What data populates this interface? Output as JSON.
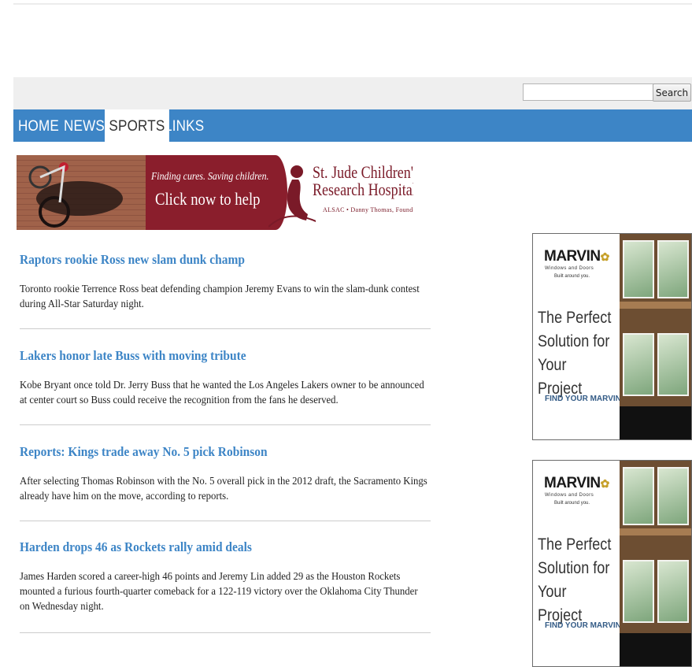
{
  "search": {
    "placeholder": "",
    "value": "",
    "button_label": "Search"
  },
  "nav": {
    "items": [
      {
        "label": "HOME"
      },
      {
        "label": "NEWS"
      },
      {
        "label": "SPORTS",
        "active": true
      },
      {
        "label": "LINKS"
      }
    ]
  },
  "banner": {
    "tagline": "Finding cures. Saving children.",
    "cta": "Click now to help",
    "org_line1": "St. Jude Children's",
    "org_line2": "Research Hospital",
    "org_sub": "ALSAC • Danny Thomas, Founder"
  },
  "articles": [
    {
      "title": "Raptors rookie Ross new slam dunk champ",
      "summary": "Toronto rookie Terrence Ross beat defending champion Jeremy Evans to win the slam-dunk contest during All-Star Saturday night."
    },
    {
      "title": "Lakers honor late Buss with moving tribute",
      "summary": "Kobe Bryant once told Dr. Jerry Buss that he wanted the Los Angeles Lakers owner to be announced at center court so Buss could receive the recognition from the fans he deserved."
    },
    {
      "title": "Reports: Kings trade away No. 5 pick Robinson",
      "summary": "After selecting Thomas Robinson with the No. 5 overall pick in the 2012 draft, the Sacramento Kings already have him on the move, according to reports."
    },
    {
      "title": "Harden drops 46 as Rockets rally amid deals",
      "summary": "James Harden scored a career-high 46 points and Jeremy Lin added 29 as the Houston Rockets mounted a furious fourth-quarter comeback for a 122-119 victory over the Oklahoma City Thunder on Wednesday night."
    }
  ],
  "ads": [
    {
      "brand": "MARVIN",
      "brand_sub": "Windows and Doors",
      "tagline": "Built around you.",
      "headline": "The Perfect Solution for Your Project",
      "cta": "FIND YOUR MARVIN ▸"
    },
    {
      "brand": "MARVIN",
      "brand_sub": "Windows and Doors",
      "tagline": "Built around you.",
      "headline": "The Perfect Solution for Your Project",
      "cta": "FIND YOUR MARVIN ▸"
    }
  ],
  "colors": {
    "nav_bg": "#3d85c6",
    "link": "#3d85c6",
    "banner_red": "#8a1e2c",
    "search_bar_bg": "#efefef"
  }
}
